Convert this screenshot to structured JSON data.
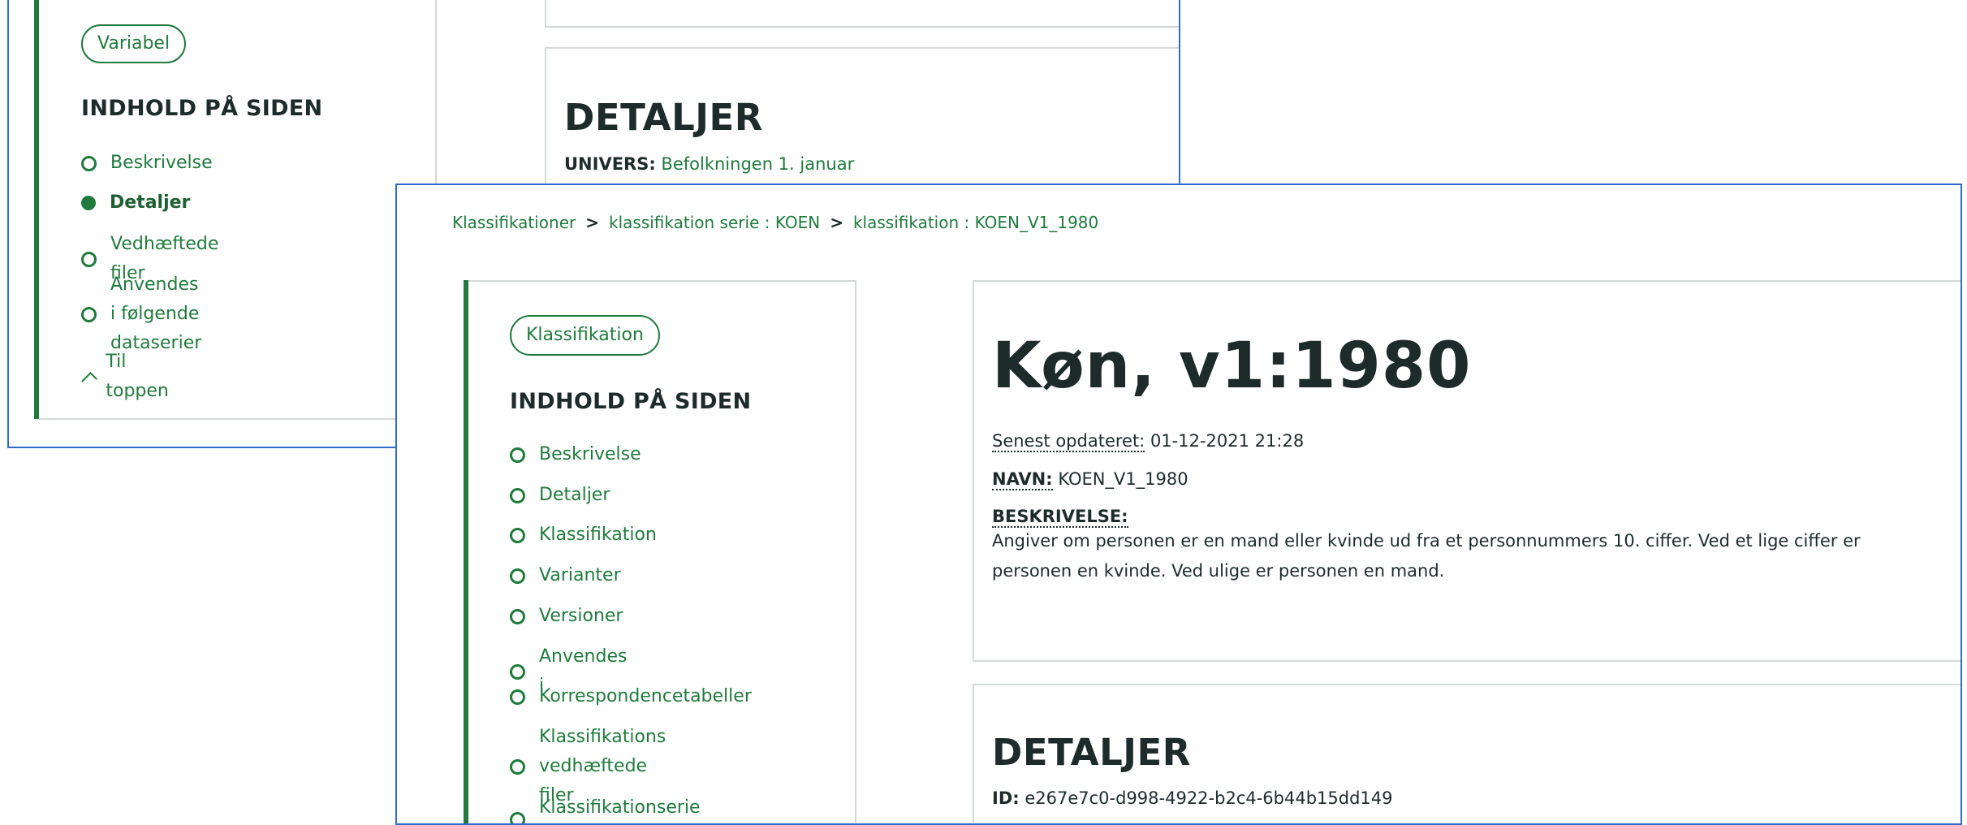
{
  "back_window": {
    "type_pill": "Variabel",
    "toc_heading": "INDHOLD PÅ SIDEN",
    "toc_items": [
      {
        "label": "Beskrivelse",
        "active": false
      },
      {
        "label": "Detaljer",
        "active": true
      },
      {
        "label": "Vedhæftede filer",
        "active": false
      },
      {
        "label_line1": "Anvendes i følgende",
        "label_line2": "dataserier",
        "active": false
      }
    ],
    "to_top": "Til toppen",
    "details_heading": "DETALJER",
    "univers_label": "UNIVERS:",
    "univers_value": "Befolkningen 1. januar"
  },
  "front_window": {
    "breadcrumb": [
      "Klassifikationer",
      "klassifikation serie : KOEN",
      "klassifikation : KOEN_V1_1980"
    ],
    "breadcrumb_separator": ">",
    "type_pill": "Klassifikation",
    "toc_heading": "INDHOLD PÅ SIDEN",
    "toc_items": [
      "Beskrivelse",
      "Detaljer",
      "Klassifikation",
      "Varianter",
      "Versioner",
      "Anvendes i",
      "Korrespondencetabeller"
    ],
    "toc_multi": {
      "line1": "Klassifikations vedhæftede",
      "line2": "filer"
    },
    "toc_last": "Klassifikationserie",
    "title": "Køn, v1:1980",
    "updated_label": "Senest opdateret:",
    "updated_value": "01-12-2021 21:28",
    "name_label": "NAVN:",
    "name_value": "KOEN_V1_1980",
    "description_label": "BESKRIVELSE:",
    "description_line1": "Angiver om personen er en mand eller kvinde ud fra et personnummers 10. ciffer. Ved et lige ciffer er",
    "description_line2": "personen en kvinde. Ved ulige er personen en mand.",
    "details_heading": "DETALJER",
    "id_label": "ID:",
    "id_value": "e267e7c0-d998-4922-b2c4-6b44b15dd149"
  },
  "colors": {
    "accent": "#1f7a3c",
    "window_border": "#2f6bc9",
    "panel_border": "#d4d8d8",
    "text": "#1d2b2b"
  }
}
